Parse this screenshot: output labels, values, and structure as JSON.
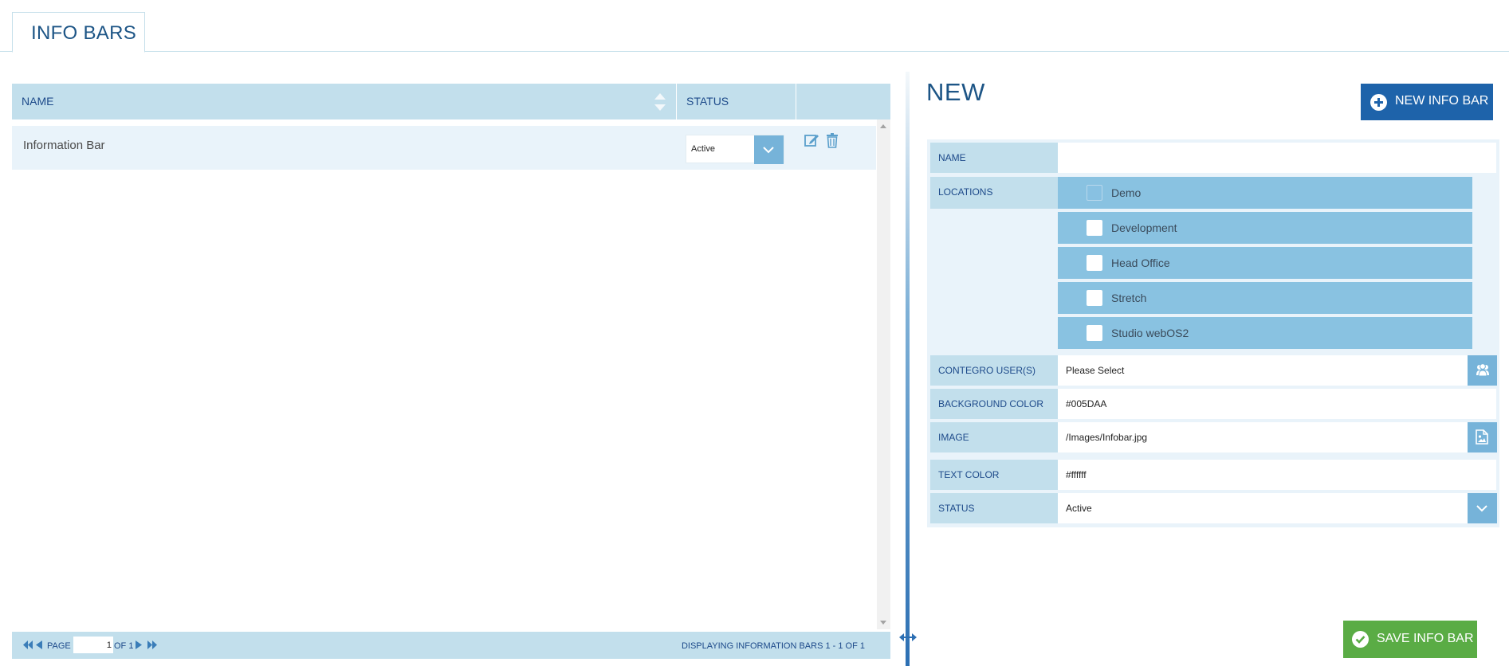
{
  "tab": {
    "title": "INFO BARS"
  },
  "grid": {
    "columns": {
      "name": "NAME",
      "status": "STATUS"
    },
    "rows": [
      {
        "name": "Information Bar",
        "status": "Active"
      }
    ],
    "footer": {
      "page_label": "PAGE",
      "page_value": "1",
      "of_label": "OF 1",
      "display_info": "DISPLAYING INFORMATION BARS 1 - 1 OF 1"
    }
  },
  "form": {
    "title": "NEW",
    "new_button": "NEW INFO BAR",
    "name": {
      "label": "NAME",
      "value": ""
    },
    "locations": {
      "label": "LOCATIONS",
      "items": [
        "Demo",
        "Development",
        "Head Office",
        "Stretch",
        "Studio webOS2"
      ]
    },
    "users": {
      "label": "CONTEGRO USER(S)",
      "value": "Please Select"
    },
    "background_color": {
      "label": "BACKGROUND COLOR",
      "value": "#005DAA"
    },
    "image": {
      "label": "IMAGE",
      "value": "/Images/Infobar.jpg"
    },
    "text_color": {
      "label": "TEXT COLOR",
      "value": "#ffffff"
    },
    "status": {
      "label": "STATUS",
      "value": "Active"
    },
    "save_button": "SAVE INFO BAR"
  },
  "colors": {
    "accent": "#1e63aa",
    "header_bg": "#c2dfec",
    "save_green": "#5aac45"
  }
}
